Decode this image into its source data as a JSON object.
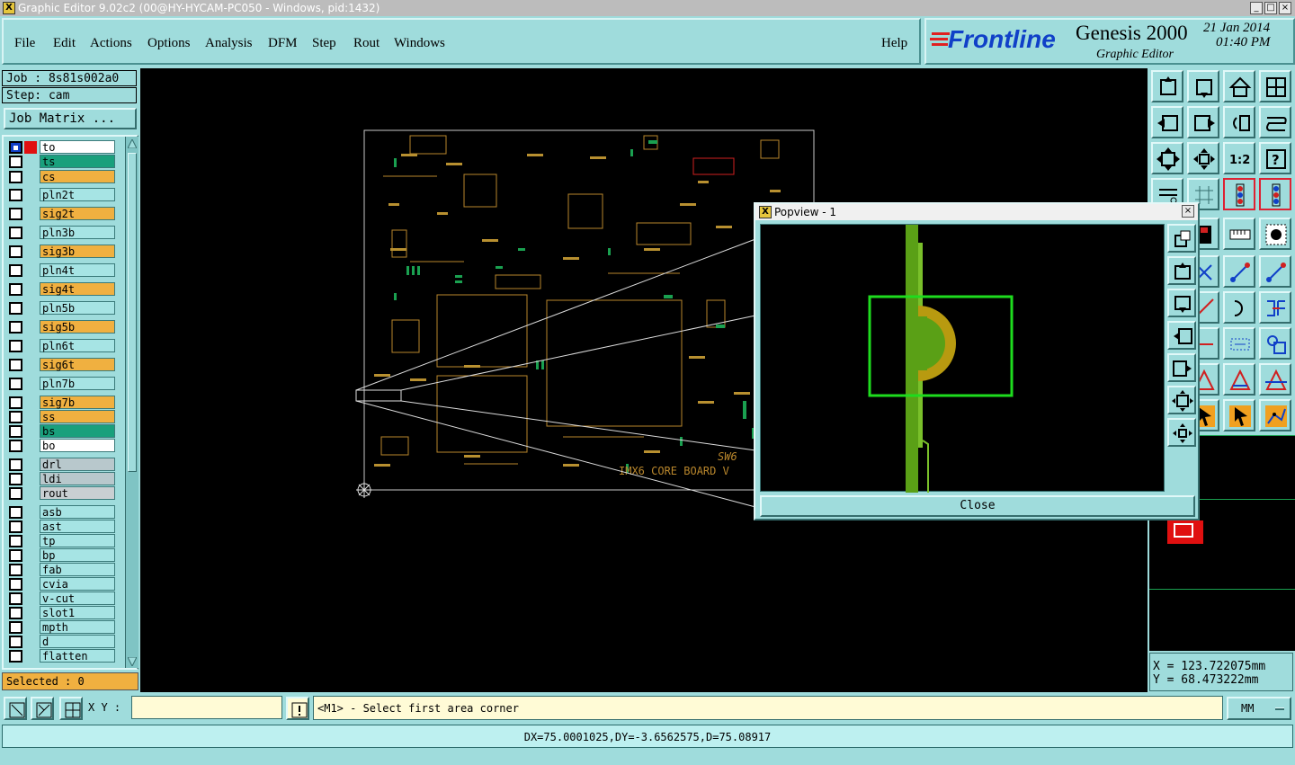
{
  "window": {
    "title": "Graphic Editor 9.02c2 (00@HY-HYCAM-PC050 - Windows, pid:1432)"
  },
  "menu": {
    "file": "File",
    "edit": "Edit",
    "actions": "Actions",
    "options": "Options",
    "analysis": "Analysis",
    "dfm": "DFM",
    "step": "Step",
    "rout": "Rout",
    "windows": "Windows",
    "help": "Help"
  },
  "brand": {
    "company": "Frontline",
    "product": "Genesis 2000",
    "subtitle": "Graphic Editor",
    "date": "21 Jan 2014",
    "time": "01:40 PM"
  },
  "job": {
    "job_label": "Job : 8s81s002a0",
    "step_label": "Step: cam",
    "matrix_button": "Job Matrix ..."
  },
  "layers": [
    {
      "name": "to",
      "color": "white",
      "checked": true
    },
    {
      "name": "ts",
      "color": "green"
    },
    {
      "name": "cs",
      "color": "sig"
    },
    {
      "name": "pln2t",
      "color": "pln"
    },
    {
      "name": "sig2t",
      "color": "sig"
    },
    {
      "name": "pln3b",
      "color": "pln"
    },
    {
      "name": "sig3b",
      "color": "sig"
    },
    {
      "name": "pln4t",
      "color": "pln"
    },
    {
      "name": "sig4t",
      "color": "sig"
    },
    {
      "name": "pln5b",
      "color": "pln"
    },
    {
      "name": "sig5b",
      "color": "sig"
    },
    {
      "name": "pln6t",
      "color": "pln"
    },
    {
      "name": "sig6t",
      "color": "sig"
    },
    {
      "name": "pln7b",
      "color": "pln"
    },
    {
      "name": "sig7b",
      "color": "sig"
    },
    {
      "name": "ss",
      "color": "sig"
    },
    {
      "name": "bs",
      "color": "green"
    },
    {
      "name": "bo",
      "color": "white"
    },
    {
      "name": "drl",
      "color": "drl"
    },
    {
      "name": "ldi",
      "color": "drl"
    },
    {
      "name": "rout",
      "color": "gray"
    },
    {
      "name": "asb",
      "color": "pln"
    },
    {
      "name": "ast",
      "color": "pln"
    },
    {
      "name": "tp",
      "color": "pln"
    },
    {
      "name": "bp",
      "color": "pln"
    },
    {
      "name": "fab",
      "color": "pln"
    },
    {
      "name": "cvia",
      "color": "pln"
    },
    {
      "name": "v-cut",
      "color": "pln"
    },
    {
      "name": "slot1",
      "color": "pln"
    },
    {
      "name": "mpth",
      "color": "pln"
    },
    {
      "name": "d",
      "color": "pln"
    },
    {
      "name": "flatten",
      "color": "pln"
    }
  ],
  "selected": "Selected : 0",
  "board": {
    "label": "IMX6 CORE BOARD V",
    "sw_label": "SW6"
  },
  "popview": {
    "title": "Popview - 1",
    "close_label": "Close"
  },
  "coords": {
    "x": "X  =  123.722075mm",
    "y": "Y  =   68.473222mm"
  },
  "status": {
    "xy_label": "X Y :",
    "xy_value": "",
    "prompt": "<M1> - Select first area corner",
    "units": "MM"
  },
  "measure": "DX=75.0001025,DY=-3.6562575,D=75.08917",
  "colors": {
    "panel": "#9fdcdc",
    "signal": "#f0b040",
    "plane": "#a6e4e4",
    "green": "#19a07c",
    "trace": "#b8862c"
  }
}
